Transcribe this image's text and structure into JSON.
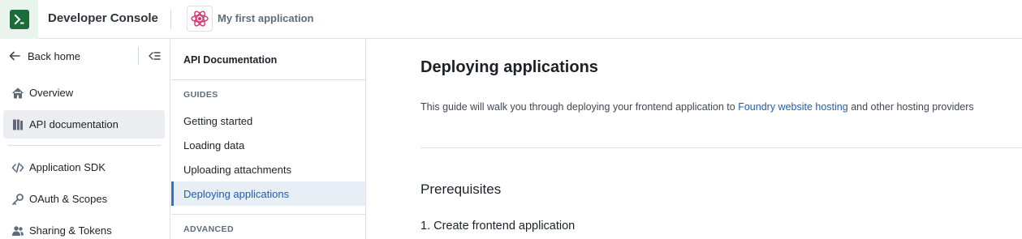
{
  "topbar": {
    "logo_icon": "developer-console-logo",
    "title": "Developer Console",
    "app_icon": "atom-icon",
    "app_name": "My first application",
    "accent": "#1c6b3a",
    "app_icon_color": "#d6336c"
  },
  "sidebar": {
    "back_label": "Back home",
    "collapse_icon": "collapse-menu-icon",
    "items": [
      {
        "label": "Overview",
        "icon": "home-icon"
      },
      {
        "label": "API documentation",
        "icon": "book-icon",
        "active": true
      },
      {
        "label": "Application SDK",
        "icon": "code-icon"
      },
      {
        "label": "OAuth & Scopes",
        "icon": "key-icon"
      },
      {
        "label": "Sharing & Tokens",
        "icon": "people-icon"
      }
    ]
  },
  "docnav": {
    "title": "API Documentation",
    "guides_header": "GUIDES",
    "guides": [
      {
        "label": "Getting started"
      },
      {
        "label": "Loading data"
      },
      {
        "label": "Uploading attachments"
      },
      {
        "label": "Deploying applications",
        "active": true
      }
    ],
    "advanced_header": "ADVANCED"
  },
  "main": {
    "title": "Deploying applications",
    "intro_before": "This guide will walk you through deploying your frontend application to ",
    "intro_link": "Foundry website hosting",
    "intro_after": " and other hosting providers",
    "h2": "Prerequisites",
    "h3": "1. Create frontend application",
    "link_color": "#215db0"
  }
}
